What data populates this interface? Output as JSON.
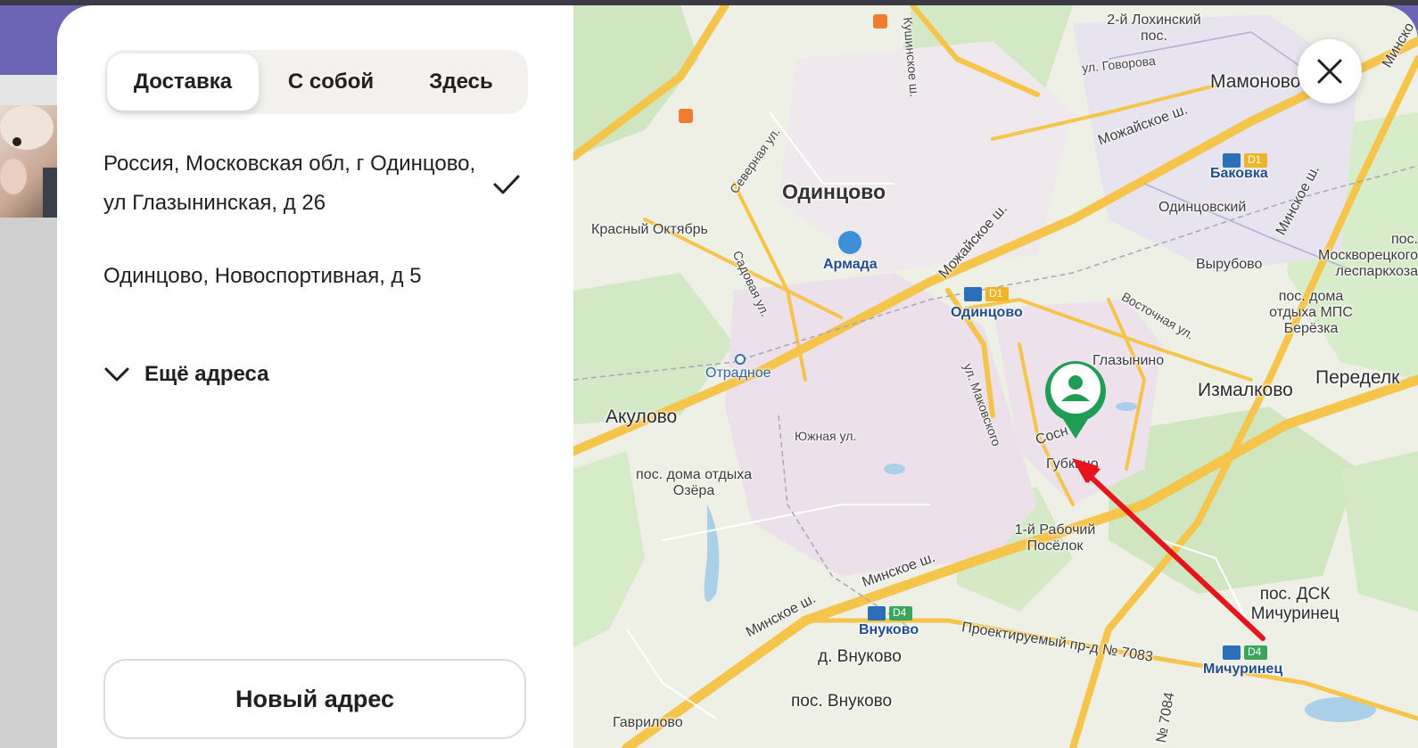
{
  "tabs": [
    {
      "label": "Доставка",
      "active": true
    },
    {
      "label": "С собой",
      "active": false
    },
    {
      "label": "Здесь",
      "active": false
    }
  ],
  "addresses": [
    {
      "text": "Россия, Московская обл, г Одинцово, ул Глазынинская, д 26",
      "selected": true
    },
    {
      "text": "Одинцово, Новоспортивная, д 5",
      "selected": false
    }
  ],
  "more_addresses_label": "Ещё адреса",
  "new_address_label": "Новый адрес",
  "map": {
    "labels": {
      "odintsovo_city": "Одинцово",
      "armada": "Армада",
      "krasny_oktyabr": "Красный Октябрь",
      "otradnoe": "Отрадное",
      "akulovo": "Акулово",
      "yuzhnaya": "Южная ул.",
      "pos_ozera": "пос. дома отдыха Озёра",
      "lokhinsky": "2-й Лохинский пос.",
      "govorova": "ул. Говорова",
      "mamonovo": "Мамоново",
      "mozhayskoe_1": "Можайское ш.",
      "mozhayskoe_2": "Можайское ш.",
      "bakovka": "Баковка",
      "odintsovsky": "Одинцовский",
      "pos_moskvoretsky": "пос. Москворецкого леспаркхоза",
      "vyrubovo": "Вырубово",
      "pos_mps": "пос. дома отдыха МПС Берёзка",
      "odintsovo_station": "Одинцово",
      "vostochnaya": "Восточная ул.",
      "glazynino": "Глазынино",
      "izmalkovo": "Измалково",
      "peredelki": "Переделк",
      "makovskogo": "ул. Маковского",
      "sosn": "Сосн",
      "gubkino": "Губкино",
      "rabochy": "1-й Рабочий Посёлок",
      "minskoe_1": "Минское ш.",
      "minskoe_2": "Минское ш.",
      "minskoe_3": "Минско",
      "minskoe_4": "Минское ш.",
      "vnukovo_station": "Внуково",
      "d_vnukovo": "д. Внуково",
      "pos_vnukovo": "пос. Внуково",
      "gavrilovo": "Гаврилово",
      "proektiruemy": "Проектируемый пр-д № 7083",
      "no7084": "№ 7084",
      "pos_dsk": "пос. ДСК Мичуринец",
      "michurinets": "Мичуринец",
      "severnaya": "Северная ул.",
      "sadovaya": "Садовая ул.",
      "kushinskoe": "Кушинское ш.",
      "d1_a": "D1",
      "d1_b": "D1",
      "d4_a": "D4",
      "d4_b": "D4"
    }
  },
  "colors": {
    "accent_pin": "#1f9d55",
    "arrow": "#e5141e",
    "header": "#6b63b3"
  }
}
